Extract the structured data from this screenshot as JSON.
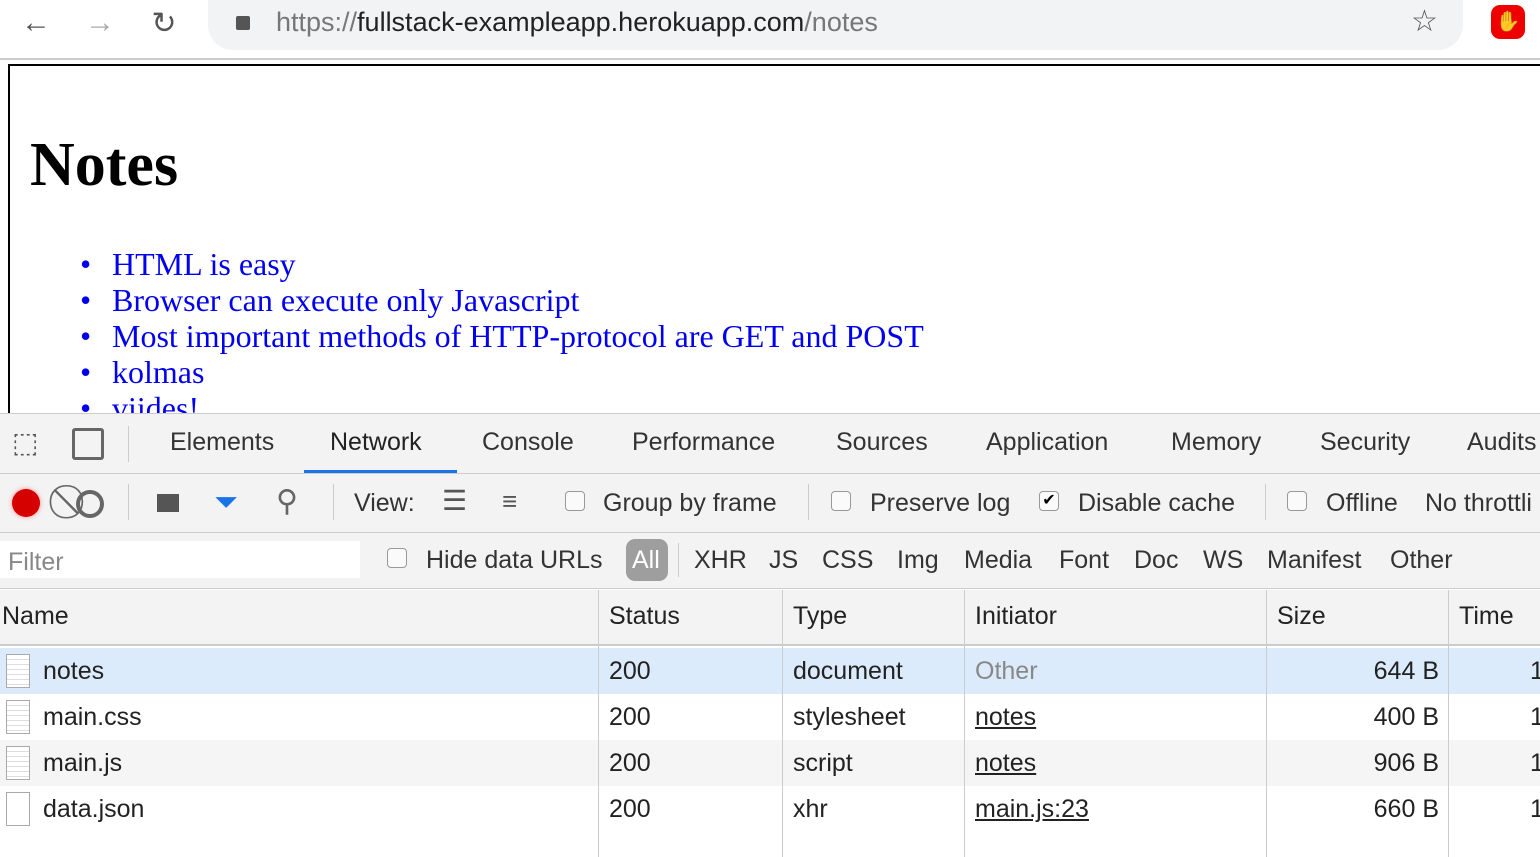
{
  "browser": {
    "url_scheme": "https://",
    "url_host": "fullstack-exampleapp.herokuapp.com",
    "url_path": "/notes"
  },
  "page": {
    "title": "Notes",
    "notes": [
      "HTML is easy",
      "Browser can execute only Javascript",
      "Most important methods of HTTP-protocol are GET and POST",
      "kolmas",
      "viides!"
    ]
  },
  "devtools": {
    "tabs": [
      "Elements",
      "Network",
      "Console",
      "Performance",
      "Sources",
      "Application",
      "Memory",
      "Security",
      "Audits"
    ],
    "active_tab": "Network",
    "toolbar": {
      "view_label": "View:",
      "group_by_frame": "Group by frame",
      "preserve_log": "Preserve log",
      "disable_cache": "Disable cache",
      "offline": "Offline",
      "throttling": "No throttli"
    },
    "filter": {
      "placeholder": "Filter",
      "hide_data_urls": "Hide data URLs",
      "types": [
        "All",
        "XHR",
        "JS",
        "CSS",
        "Img",
        "Media",
        "Font",
        "Doc",
        "WS",
        "Manifest",
        "Other"
      ]
    },
    "columns": [
      "Name",
      "Status",
      "Type",
      "Initiator",
      "Size",
      "Time"
    ],
    "rows": [
      {
        "name": "notes",
        "status": "200",
        "type": "document",
        "initiator": "Other",
        "size": "644 B",
        "time": "1"
      },
      {
        "name": "main.css",
        "status": "200",
        "type": "stylesheet",
        "initiator": "notes",
        "size": "400 B",
        "time": "1"
      },
      {
        "name": "main.js",
        "status": "200",
        "type": "script",
        "initiator": "notes",
        "size": "906 B",
        "time": "1"
      },
      {
        "name": "data.json",
        "status": "200",
        "type": "xhr",
        "initiator": "main.js:23",
        "size": "660 B",
        "time": "1"
      }
    ]
  },
  "colors": {
    "accent": "#1a73e8",
    "record": "#d50000",
    "selected_row": "#dcebfc",
    "link": "#0000ee"
  }
}
